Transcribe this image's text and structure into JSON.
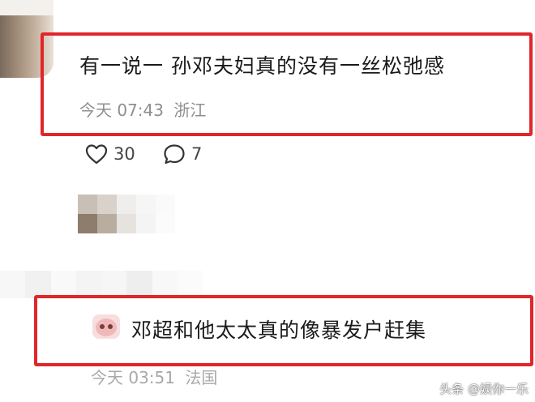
{
  "comment1": {
    "text": "有一说一 孙邓夫妇真的没有一丝松弛感",
    "time": "今天 07:43",
    "location": "浙江",
    "likes": "30",
    "replies": "7"
  },
  "comment2": {
    "text": "邓超和他太太真的像暴发户赶集",
    "time": "今天 03:51",
    "location": "法国"
  },
  "watermark": "头条 @娱你一乐",
  "colors": {
    "highlight": "#e0262a",
    "meta": "#8f8f8f"
  },
  "icons": [
    "heart-icon",
    "comment-icon",
    "sticker-emoji-icon"
  ]
}
